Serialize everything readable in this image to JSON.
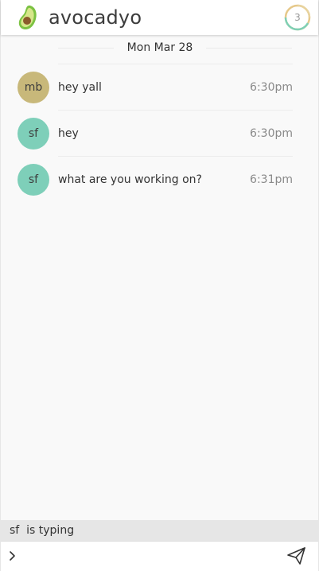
{
  "app": {
    "title": "avocadyo",
    "logo_icon": "avocado-icon",
    "badge_count": "3",
    "colors": {
      "avocado_skin": "#7cc242",
      "avocado_flesh": "#d6e68a",
      "avocado_pit": "#8b5a2b",
      "badge_ring_green": "#7fd0b5",
      "badge_ring_gold": "#e6c88a"
    }
  },
  "chat": {
    "date": "Mon Mar 28",
    "messages": [
      {
        "initials": "mb",
        "text": "hey yall",
        "time": "6:30pm",
        "avatar_color": "#c8b87a"
      },
      {
        "initials": "sf",
        "text": "hey",
        "time": "6:30pm",
        "avatar_color": "#7ecfb9"
      },
      {
        "initials": "sf",
        "text": "what are you working on?",
        "time": "6:31pm",
        "avatar_color": "#7ecfb9"
      }
    ]
  },
  "typing": {
    "user": "sf",
    "label": "is typing"
  },
  "composer": {
    "value": "",
    "placeholder": "",
    "prompt_icon": "chevron-right-icon",
    "send_icon": "paper-plane-icon"
  }
}
